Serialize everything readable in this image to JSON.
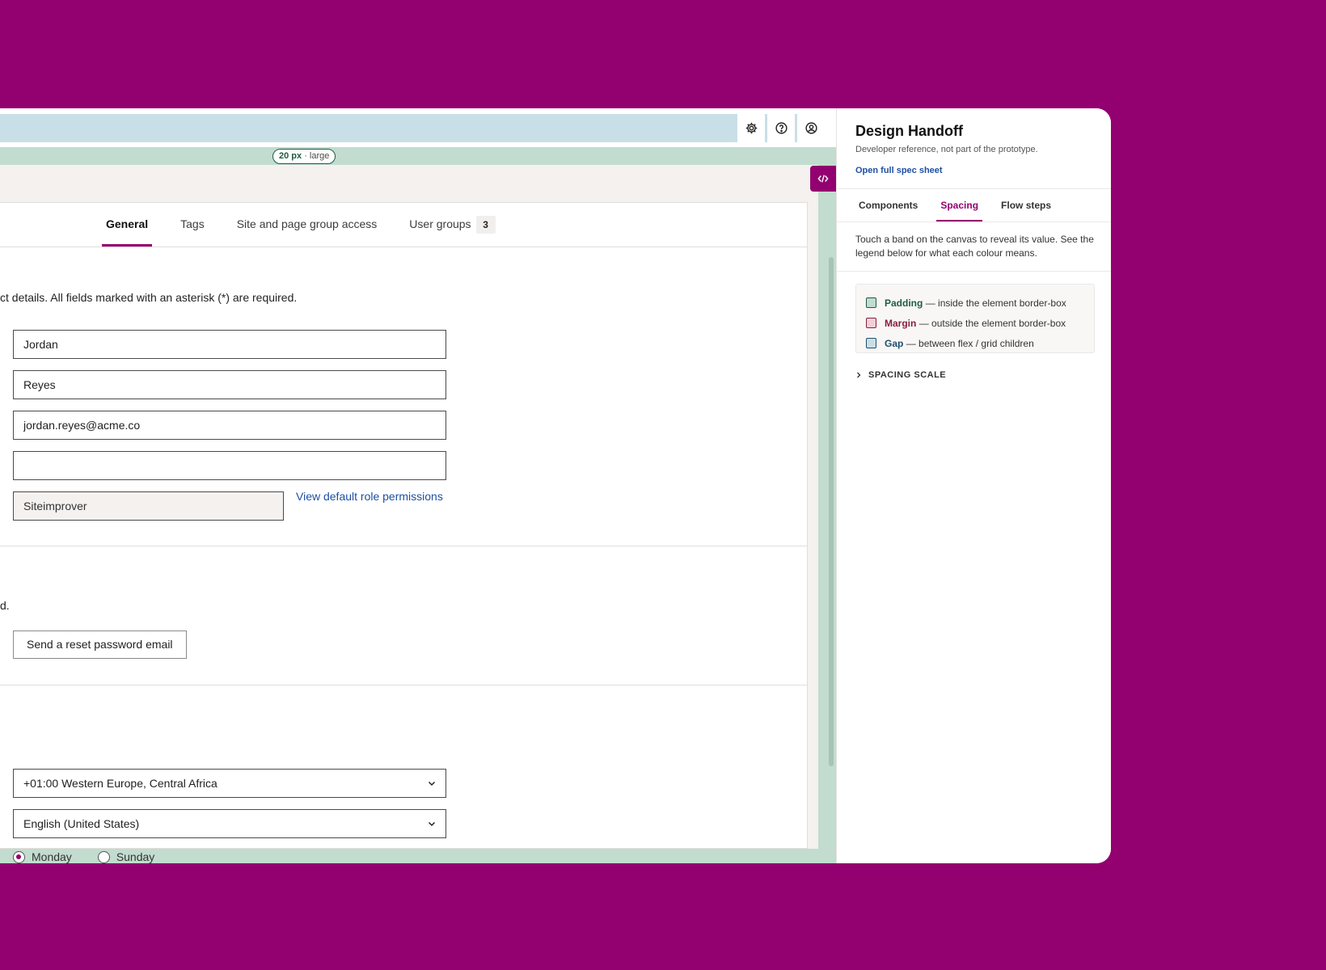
{
  "topbar": {
    "icons": [
      "gear-icon",
      "help-icon",
      "user-icon"
    ]
  },
  "spacing_pill": {
    "value": "20 px",
    "label": "· large"
  },
  "tabs": [
    {
      "label": "General",
      "active": true
    },
    {
      "label": "Tags",
      "active": false
    },
    {
      "label": "Site and page group access",
      "active": false
    },
    {
      "label": "User groups",
      "count": "3",
      "active": false
    }
  ],
  "form": {
    "intro": "ct details. All fields marked with an asterisk (*) are required.",
    "first_name": "Jordan",
    "last_name": "Reyes",
    "email": "jordan.reyes@acme.co",
    "empty_field": "",
    "role": "Siteimprover",
    "role_link": "View default role permissions",
    "password_text": "d.",
    "reset_button": "Send a reset password email",
    "timezone": "+01:00 Western Europe, Central Africa",
    "language": "English (United States)",
    "week_start": [
      {
        "label": "Monday",
        "checked": true
      },
      {
        "label": "Sunday",
        "checked": false
      }
    ]
  },
  "panel": {
    "title": "Design Handoff",
    "subtitle": "Developer reference, not part of the prototype.",
    "link": "Open full spec sheet",
    "tabs": [
      {
        "label": "Components",
        "active": false
      },
      {
        "label": "Spacing",
        "active": true
      },
      {
        "label": "Flow steps",
        "active": false
      }
    ],
    "description": "Touch a band on the canvas to reveal its value. See the legend below for what each colour means.",
    "legend": [
      {
        "name": "Padding",
        "desc": "— inside the element border-box",
        "color": "#c2dccf",
        "text_color": "#1d5c46"
      },
      {
        "name": "Margin",
        "desc": "— outside the element border-box",
        "color": "#f0cfd6",
        "text_color": "#8a1f3d"
      },
      {
        "name": "Gap",
        "desc": "— between flex / grid children",
        "color": "#c9dfe7",
        "text_color": "#1f4f6e"
      }
    ],
    "scale_label": "SPACING SCALE"
  },
  "colors": {
    "brand": "#930070",
    "link": "#1f4fa3",
    "padding_band": "#c2dccf",
    "gap_band": "#c9dfe7"
  }
}
